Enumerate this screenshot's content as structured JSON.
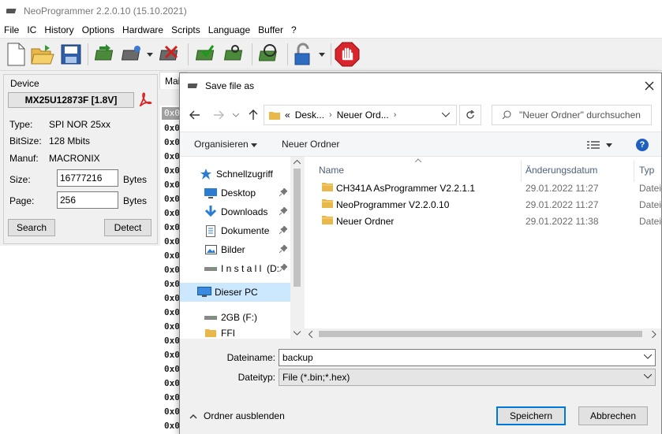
{
  "app": {
    "title": "NeoProgrammer 2.2.0.10 (15.10.2021)"
  },
  "menu": [
    "File",
    "IC",
    "History",
    "Options",
    "Hardware",
    "Scripts",
    "Language",
    "Buffer",
    "?"
  ],
  "device": {
    "legend": "Device",
    "chip": "MX25U12873F [1.8V]",
    "type_label": "Type:",
    "type_value": "SPI NOR  25xx",
    "bitsize_label": "BitSize:",
    "bitsize_value": "128 Mbits",
    "manuf_label": "Manuf:",
    "manuf_value": "MACRONIX",
    "size_label": "Size:",
    "size_value": "16777216",
    "size_unit": "Bytes",
    "page_label": "Page:",
    "page_value": "256",
    "page_unit": "Bytes",
    "search_label": "Search",
    "detect_label": "Detect"
  },
  "hex": {
    "tab": "Main",
    "header": "0x0",
    "row_prefix": "0x0"
  },
  "dialog": {
    "title": "Save file as",
    "address": {
      "overflow": "«",
      "crumbs": [
        "Desk...",
        "Neuer Ord..."
      ]
    },
    "search_placeholder": "\"Neuer Ordner\" durchsuchen",
    "organize": "Organisieren",
    "new_folder": "Neuer Ordner",
    "nav": [
      {
        "label": "Schnellzugriff",
        "icon": "star-icon"
      },
      {
        "label": "Desktop",
        "icon": "desktop-icon",
        "pinned": true
      },
      {
        "label": "Downloads",
        "icon": "download-icon",
        "pinned": true
      },
      {
        "label": "Dokumente",
        "icon": "document-icon",
        "pinned": true
      },
      {
        "label": "Bilder",
        "icon": "picture-icon",
        "pinned": true
      },
      {
        "label": "I n s t a l l  (D:",
        "icon": "drive-icon",
        "pinned": true
      },
      {
        "label": "Dieser PC",
        "icon": "pc-icon",
        "selected": true
      },
      {
        "label": "2GB (F:)",
        "icon": "usb-drive-icon"
      },
      {
        "label": "FFI",
        "icon": "folder-icon"
      }
    ],
    "columns": {
      "name": "Name",
      "date": "Änderungsdatum",
      "type": "Typ"
    },
    "files": [
      {
        "name": "CH341A AsProgrammer V2.2.1.1",
        "date": "29.01.2022 11:27",
        "type": "Dateiordner"
      },
      {
        "name": "NeoProgrammer V2.2.0.10",
        "date": "29.01.2022 11:27",
        "type": "Dateiordner"
      },
      {
        "name": "Neuer Ordner",
        "date": "29.01.2022 11:38",
        "type": "Dateiordner"
      }
    ],
    "filename_label": "Dateiname:",
    "filename_value": "backup",
    "filetype_label": "Dateityp:",
    "filetype_value": "File (*.bin;*.hex)",
    "hide_folders": "Ordner ausblenden",
    "save": "Speichern",
    "cancel": "Abbrechen"
  },
  "colors": {
    "accent": "#0078d7",
    "selection": "#cce8ff",
    "folder": "#e8b84a",
    "stop": "#d9262c"
  }
}
